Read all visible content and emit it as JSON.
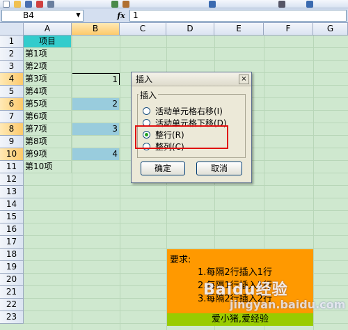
{
  "formula_bar": {
    "name_box": "B4",
    "fx_label": "fx",
    "formula_value": "1"
  },
  "columns": [
    "A",
    "B",
    "C",
    "D",
    "E",
    "F",
    "G"
  ],
  "rows": [
    "1",
    "2",
    "3",
    "4",
    "5",
    "6",
    "7",
    "8",
    "9",
    "10",
    "11",
    "12",
    "13",
    "14",
    "15",
    "16",
    "17",
    "18",
    "19",
    "20",
    "21",
    "22",
    "23"
  ],
  "column_a": [
    "项目",
    "第1项",
    "第2项",
    "第3项",
    "第4项",
    "第5项",
    "第6项",
    "第7项",
    "第8项",
    "第9项",
    "第10项"
  ],
  "column_b": {
    "r4": "1",
    "r6": "2",
    "r8": "3",
    "r10": "4"
  },
  "requirements": {
    "heading": "要求:",
    "item1": "1.每隔2行插入1行",
    "item2": "2.每隔1行插入1行",
    "item3": "3.每隔2行插入2行",
    "footer": "爱小猪,爱经验"
  },
  "watermark": {
    "main": "Baidu经验",
    "sub": "jingyan.baidu.com"
  },
  "dialog": {
    "title": "插入",
    "group_label": "插入",
    "options": [
      "活动单元格右移(I)",
      "活动单元格下移(D)",
      "整行(R)",
      "整列(C)"
    ],
    "selected_option": "整行(R)",
    "ok_label": "确定",
    "cancel_label": "取消",
    "close_label": "×"
  },
  "colors": {
    "header_cell": "#33cccc",
    "highlight_row": "#99ccdd",
    "requirement_block": "#ff9900",
    "footer_bar": "#99cc00",
    "annotation_box": "#e01010"
  }
}
